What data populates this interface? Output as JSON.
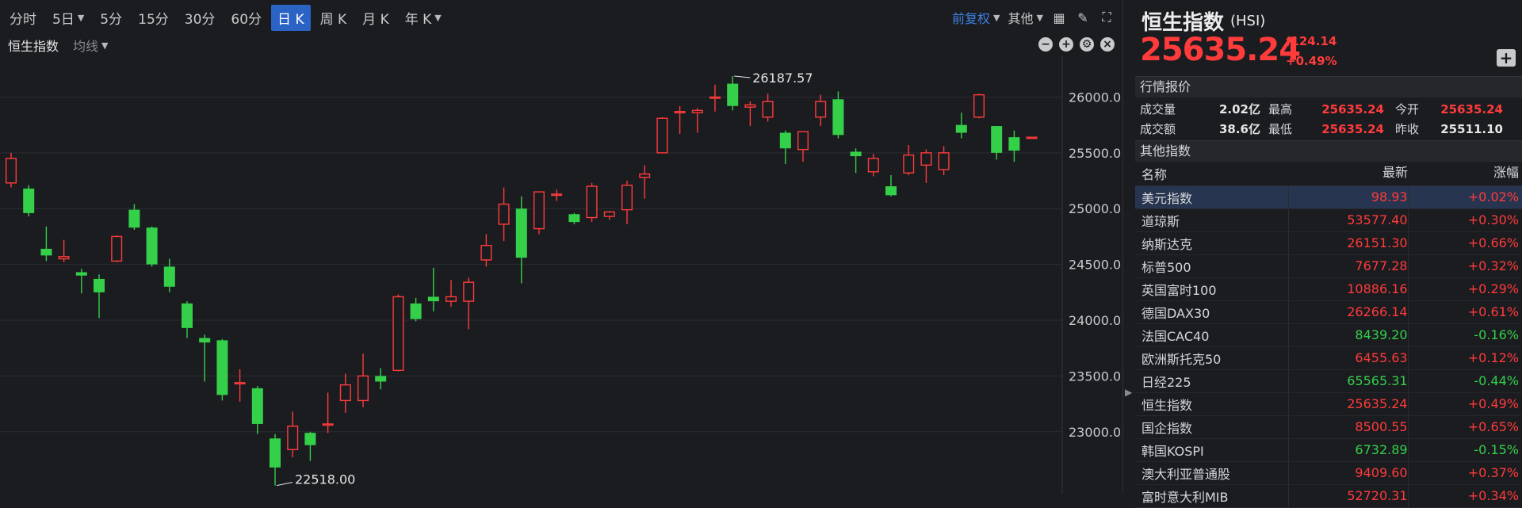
{
  "toolbar": {
    "timeframes": [
      {
        "label": "分时",
        "caret": false,
        "active": false
      },
      {
        "label": "5日",
        "caret": true,
        "active": false
      },
      {
        "label": "5分",
        "caret": false,
        "active": false
      },
      {
        "label": "15分",
        "caret": false,
        "active": false
      },
      {
        "label": "30分",
        "caret": false,
        "active": false
      },
      {
        "label": "60分",
        "caret": false,
        "active": false
      },
      {
        "label": "日 K",
        "caret": false,
        "active": true
      },
      {
        "label": "周 K",
        "caret": false,
        "active": false
      },
      {
        "label": "月 K",
        "caret": false,
        "active": false
      },
      {
        "label": "年 K",
        "caret": true,
        "active": false
      }
    ],
    "adjust_label": "前复权",
    "other_label": "其他"
  },
  "subbar": {
    "indicator": "恒生指数",
    "ma_label": "均线"
  },
  "colors": {
    "up": "#ff3b3b",
    "down": "#35d04a",
    "accent": "#2a63c4",
    "background": "#1b1c20"
  },
  "chart_data": {
    "type": "candlestick",
    "y_ticks": [
      "26000.0",
      "25500.0",
      "25000.0",
      "24500.0",
      "24000.0",
      "23500.0",
      "23000.0"
    ],
    "y_tick_values": [
      26000,
      25500,
      25000,
      24500,
      24000,
      23500,
      23000
    ],
    "ylim": [
      22480,
      26330
    ],
    "annotations": {
      "high": "26187.57",
      "low": "22518.00"
    },
    "candles": [
      {
        "o": 25230,
        "h": 25500,
        "l": 25190,
        "c": 25450
      },
      {
        "o": 25180,
        "h": 25210,
        "l": 24930,
        "c": 24960
      },
      {
        "o": 24640,
        "h": 24840,
        "l": 24530,
        "c": 24580
      },
      {
        "o": 24550,
        "h": 24720,
        "l": 24520,
        "c": 24570
      },
      {
        "o": 24430,
        "h": 24460,
        "l": 24240,
        "c": 24400
      },
      {
        "o": 24370,
        "h": 24410,
        "l": 24020,
        "c": 24250
      },
      {
        "o": 24530,
        "h": 24760,
        "l": 24520,
        "c": 24750
      },
      {
        "o": 24990,
        "h": 25040,
        "l": 24810,
        "c": 24830
      },
      {
        "o": 24830,
        "h": 24840,
        "l": 24480,
        "c": 24500
      },
      {
        "o": 24480,
        "h": 24550,
        "l": 24250,
        "c": 24300
      },
      {
        "o": 24150,
        "h": 24170,
        "l": 23840,
        "c": 23930
      },
      {
        "o": 23840,
        "h": 23870,
        "l": 23450,
        "c": 23800
      },
      {
        "o": 23820,
        "h": 23830,
        "l": 23280,
        "c": 23330
      },
      {
        "o": 23440,
        "h": 23560,
        "l": 23270,
        "c": 23440
      },
      {
        "o": 23390,
        "h": 23410,
        "l": 22980,
        "c": 23070
      },
      {
        "o": 22940,
        "h": 22980,
        "l": 22518,
        "c": 22680
      },
      {
        "o": 22840,
        "h": 23180,
        "l": 22770,
        "c": 23050
      },
      {
        "o": 22990,
        "h": 23000,
        "l": 22740,
        "c": 22880
      },
      {
        "o": 23070,
        "h": 23350,
        "l": 22990,
        "c": 23070
      },
      {
        "o": 23280,
        "h": 23520,
        "l": 23170,
        "c": 23420
      },
      {
        "o": 23280,
        "h": 23700,
        "l": 23220,
        "c": 23500
      },
      {
        "o": 23500,
        "h": 23570,
        "l": 23380,
        "c": 23450
      },
      {
        "o": 23550,
        "h": 24230,
        "l": 23540,
        "c": 24210
      },
      {
        "o": 24150,
        "h": 24200,
        "l": 23990,
        "c": 24010
      },
      {
        "o": 24210,
        "h": 24470,
        "l": 24080,
        "c": 24170
      },
      {
        "o": 24170,
        "h": 24360,
        "l": 24120,
        "c": 24210
      },
      {
        "o": 24170,
        "h": 24380,
        "l": 23920,
        "c": 24340
      },
      {
        "o": 24540,
        "h": 24770,
        "l": 24480,
        "c": 24670
      },
      {
        "o": 24860,
        "h": 25190,
        "l": 24710,
        "c": 25040
      },
      {
        "o": 25000,
        "h": 25110,
        "l": 24330,
        "c": 24560
      },
      {
        "o": 24820,
        "h": 25150,
        "l": 24770,
        "c": 25150
      },
      {
        "o": 25130,
        "h": 25170,
        "l": 25070,
        "c": 25130
      },
      {
        "o": 24950,
        "h": 24960,
        "l": 24860,
        "c": 24880
      },
      {
        "o": 24920,
        "h": 25230,
        "l": 24880,
        "c": 25200
      },
      {
        "o": 24930,
        "h": 24980,
        "l": 24900,
        "c": 24970
      },
      {
        "o": 24990,
        "h": 25250,
        "l": 24860,
        "c": 25210
      },
      {
        "o": 25280,
        "h": 25390,
        "l": 25090,
        "c": 25310
      },
      {
        "o": 25500,
        "h": 25820,
        "l": 25500,
        "c": 25810
      },
      {
        "o": 25870,
        "h": 25920,
        "l": 25670,
        "c": 25870
      },
      {
        "o": 25860,
        "h": 25900,
        "l": 25680,
        "c": 25880
      },
      {
        "o": 25990,
        "h": 26110,
        "l": 25870,
        "c": 26000
      },
      {
        "o": 26120,
        "h": 26187.57,
        "l": 25880,
        "c": 25920
      },
      {
        "o": 25910,
        "h": 25960,
        "l": 25740,
        "c": 25930
      },
      {
        "o": 25820,
        "h": 26030,
        "l": 25780,
        "c": 25960
      },
      {
        "o": 25680,
        "h": 25700,
        "l": 25400,
        "c": 25540
      },
      {
        "o": 25530,
        "h": 25690,
        "l": 25420,
        "c": 25690
      },
      {
        "o": 25820,
        "h": 26020,
        "l": 25740,
        "c": 25960
      },
      {
        "o": 25980,
        "h": 26050,
        "l": 25630,
        "c": 25660
      },
      {
        "o": 25510,
        "h": 25540,
        "l": 25320,
        "c": 25470
      },
      {
        "o": 25330,
        "h": 25490,
        "l": 25290,
        "c": 25450
      },
      {
        "o": 25200,
        "h": 25300,
        "l": 25110,
        "c": 25120
      },
      {
        "o": 25320,
        "h": 25570,
        "l": 25300,
        "c": 25480
      },
      {
        "o": 25390,
        "h": 25530,
        "l": 25230,
        "c": 25500
      },
      {
        "o": 25350,
        "h": 25560,
        "l": 25300,
        "c": 25500
      },
      {
        "o": 25750,
        "h": 25860,
        "l": 25630,
        "c": 25680
      },
      {
        "o": 25820,
        "h": 26030,
        "l": 25810,
        "c": 26020
      },
      {
        "o": 25740,
        "h": 25740,
        "l": 25440,
        "c": 25500
      },
      {
        "o": 25640,
        "h": 25700,
        "l": 25420,
        "c": 25520
      },
      {
        "o": 25635,
        "h": 25645,
        "l": 25628,
        "c": 25640
      }
    ]
  },
  "index": {
    "name": "恒生指数",
    "code": "(HSI)",
    "price": "25635.24",
    "change": "124.14",
    "change_pct": "+0.49%"
  },
  "quote": {
    "title": "行情报价",
    "volume_label": "成交量",
    "volume": "2.02亿",
    "high_label": "最高",
    "high": "25635.24",
    "open_label": "今开",
    "open": "25635.24",
    "turnover_label": "成交额",
    "turnover": "38.6亿",
    "low_label": "最低",
    "low": "25635.24",
    "prev_label": "昨收",
    "prev": "25511.10"
  },
  "others": {
    "title": "其他指数",
    "col_name": "名称",
    "col_last": "最新",
    "col_chg": "涨幅",
    "rows": [
      {
        "name": "美元指数",
        "last": "98.93",
        "chg": "+0.02%",
        "dir": "up",
        "sel": true
      },
      {
        "name": "道琼斯",
        "last": "53577.40",
        "chg": "+0.30%",
        "dir": "up"
      },
      {
        "name": "纳斯达克",
        "last": "26151.30",
        "chg": "+0.66%",
        "dir": "up"
      },
      {
        "name": "标普500",
        "last": "7677.28",
        "chg": "+0.32%",
        "dir": "up"
      },
      {
        "name": "英国富时100",
        "last": "10886.16",
        "chg": "+0.29%",
        "dir": "up"
      },
      {
        "name": "德国DAX30",
        "last": "26266.14",
        "chg": "+0.61%",
        "dir": "up"
      },
      {
        "name": "法国CAC40",
        "last": "8439.20",
        "chg": "-0.16%",
        "dir": "dn"
      },
      {
        "name": "欧洲斯托克50",
        "last": "6455.63",
        "chg": "+0.12%",
        "dir": "up"
      },
      {
        "name": "日经225",
        "last": "65565.31",
        "chg": "-0.44%",
        "dir": "dn"
      },
      {
        "name": "恒生指数",
        "last": "25635.24",
        "chg": "+0.49%",
        "dir": "up"
      },
      {
        "name": "国企指数",
        "last": "8500.55",
        "chg": "+0.65%",
        "dir": "up"
      },
      {
        "name": "韩国KOSPI",
        "last": "6732.89",
        "chg": "-0.15%",
        "dir": "dn"
      },
      {
        "name": "澳大利亚普通股",
        "last": "9409.60",
        "chg": "+0.37%",
        "dir": "up"
      },
      {
        "name": "富时意大利MIB",
        "last": "52720.31",
        "chg": "+0.34%",
        "dir": "up"
      }
    ]
  }
}
